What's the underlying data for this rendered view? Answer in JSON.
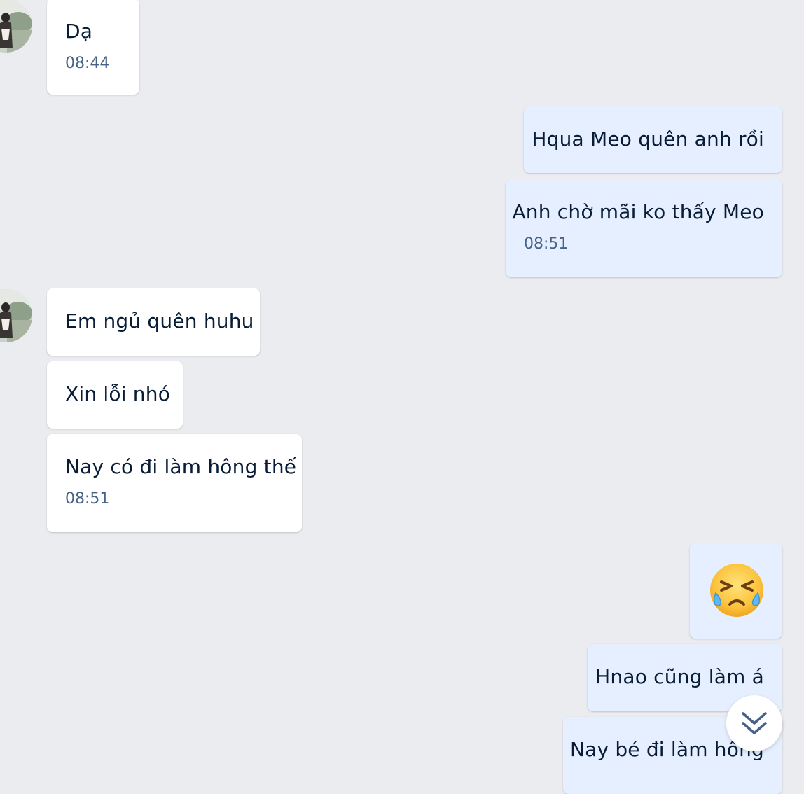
{
  "conversation": {
    "messages": [
      {
        "id": "m1",
        "direction": "incoming",
        "text": "Dạ",
        "time": "08:44"
      },
      {
        "id": "m2",
        "direction": "outgoing",
        "text": "Hqua Meo quên anh rồi"
      },
      {
        "id": "m3",
        "direction": "outgoing",
        "text": "Anh chờ mãi ko thấy Meo",
        "time": "08:51"
      },
      {
        "id": "m4",
        "direction": "incoming",
        "text": "Em ngủ quên huhu"
      },
      {
        "id": "m5",
        "direction": "incoming",
        "text": "Xin lỗi nhó"
      },
      {
        "id": "m6",
        "direction": "incoming",
        "text": "Nay có đi làm hông thế",
        "time": "08:51"
      },
      {
        "id": "m7",
        "direction": "outgoing",
        "sticker": "crying-face-emoji"
      },
      {
        "id": "m8",
        "direction": "outgoing",
        "text": "Hnao cũng làm á"
      },
      {
        "id": "m9",
        "direction": "outgoing",
        "text": "Nay bé đi làm hông"
      }
    ]
  },
  "scroll_button": {
    "icon": "double-chevron-down-icon"
  },
  "colors": {
    "background": "#eaecf0",
    "incoming_bubble": "#ffffff",
    "outgoing_bubble": "#e5efff",
    "text": "#081c36",
    "time_text": "#476285",
    "scroll_icon": "#476285"
  }
}
